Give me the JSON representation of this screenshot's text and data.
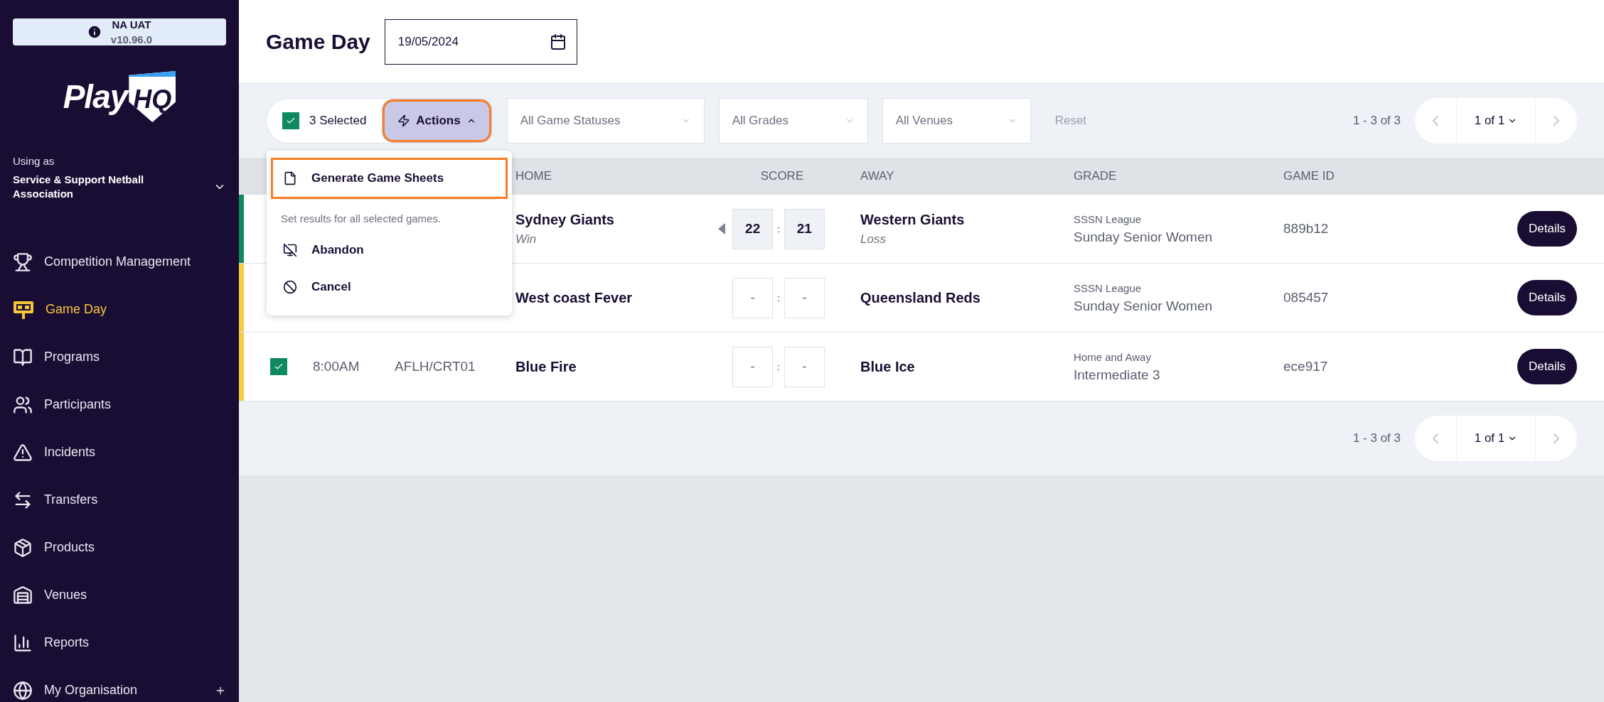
{
  "env_badge": {
    "name": "NA UAT",
    "version": "v10.96.0"
  },
  "logo": {
    "word": "Play",
    "badge": "HQ"
  },
  "org": {
    "caption": "Using as",
    "name": "Service & Support Netball Association"
  },
  "sidebar": {
    "items": [
      {
        "label": "Competition Management",
        "selected": false
      },
      {
        "label": "Game Day",
        "selected": true
      },
      {
        "label": "Programs",
        "selected": false
      },
      {
        "label": "Participants",
        "selected": false
      },
      {
        "label": "Incidents",
        "selected": false
      },
      {
        "label": "Transfers",
        "selected": false
      },
      {
        "label": "Products",
        "selected": false
      },
      {
        "label": "Venues",
        "selected": false
      },
      {
        "label": "Reports",
        "selected": false
      },
      {
        "label": "My Organisation",
        "selected": false,
        "expandable": true
      }
    ]
  },
  "page": {
    "title": "Game Day",
    "date": "19/05/2024"
  },
  "toolbar": {
    "selection": {
      "checked": true,
      "label": "3 Selected"
    },
    "actions": {
      "label": "Actions",
      "expanded": true,
      "highlighted": true
    },
    "filters": [
      "All Game Statuses",
      "All Grades",
      "All Venues"
    ],
    "reset": "Reset",
    "range": "1 - 3 of 3",
    "page": "1 of 1"
  },
  "actions_menu": {
    "items": [
      {
        "kind": "action",
        "label": "Generate Game Sheets",
        "highlighted": true
      },
      {
        "kind": "hint",
        "label": "Set results for all selected games."
      },
      {
        "kind": "action",
        "label": "Abandon",
        "highlighted": false
      },
      {
        "kind": "action",
        "label": "Cancel",
        "highlighted": false
      }
    ]
  },
  "table": {
    "columns": [
      "HOME",
      "SCORE",
      "AWAY",
      "GRADE",
      "GAME ID"
    ],
    "rows": [
      {
        "color": "#0f8a5f",
        "home": "Sydney Giants",
        "home_result": "Win",
        "home_winner": true,
        "final": true,
        "home_score": "22",
        "score_separator": ":",
        "away_score": "21",
        "away": "Western Giants",
        "away_result": "Loss",
        "competition": "SSSN League",
        "grade": "Sunday Senior Women",
        "game_id": "889b12",
        "action": "Details"
      },
      {
        "color": "#f7cd3f",
        "home": "West coast Fever",
        "home_winner": false,
        "final": false,
        "home_score": "-",
        "score_separator": ":",
        "away_score": "-",
        "away": "Queensland Reds",
        "competition": "SSSN League",
        "grade": "Sunday Senior Women",
        "game_id": "085457",
        "action": "Details"
      },
      {
        "color": "#f7cd3f",
        "checked": true,
        "time": "8:00AM",
        "court": "AFLH/CRT01",
        "home": "Blue Fire",
        "home_winner": false,
        "final": false,
        "home_score": "-",
        "score_separator": ":",
        "away_score": "-",
        "away": "Blue Ice",
        "competition": "Home and Away",
        "grade": "Intermediate 3",
        "game_id": "ece917",
        "action": "Details"
      }
    ]
  },
  "footer": {
    "range": "1 - 3 of 3",
    "page": "1 of 1"
  }
}
